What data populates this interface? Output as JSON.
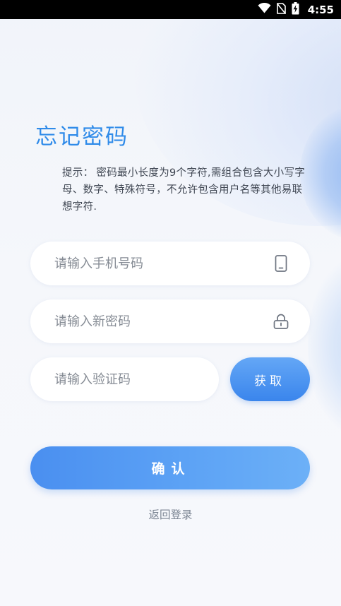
{
  "status_bar": {
    "time": "4:55",
    "icons": [
      "wifi-icon",
      "no-sim-icon",
      "battery-charging-icon"
    ]
  },
  "page": {
    "title": "忘记密码",
    "hint_label": "提示：",
    "hint_text": "密码最小长度为9个字符,需组合包含大小写字母、数字、特殊符号，不允许包含用户名等其他易联想字符."
  },
  "form": {
    "phone_placeholder": "请输入手机号码",
    "phone_icon": "mobile-phone-icon",
    "password_placeholder": "请输入新密码",
    "password_icon": "lock-icon",
    "code_placeholder": "请输入验证码",
    "get_code_label": "获取",
    "confirm_label": "确认"
  },
  "footer": {
    "back_to_login": "返回登录"
  },
  "colors": {
    "accent": "#3a85ec",
    "title": "#2f8be9"
  }
}
